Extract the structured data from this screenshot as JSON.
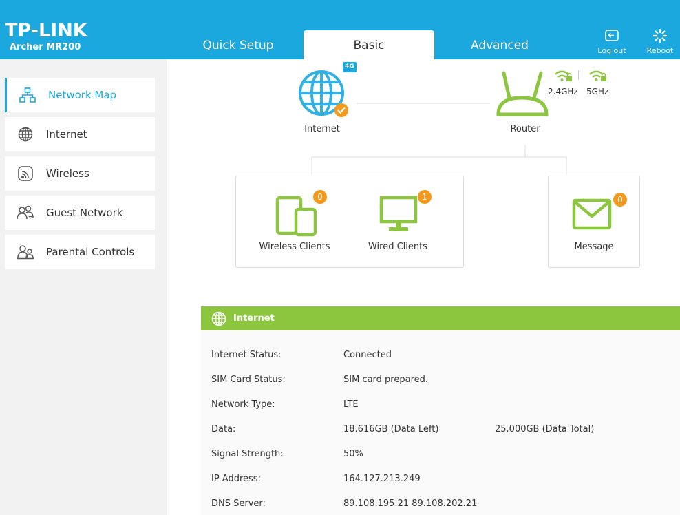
{
  "brand": {
    "logo": "TP-LINK",
    "model": "Archer MR200"
  },
  "tabs": [
    {
      "label": "Quick Setup"
    },
    {
      "label": "Basic"
    },
    {
      "label": "Advanced"
    }
  ],
  "header_buttons": {
    "logout": "Log out",
    "reboot": "Reboot"
  },
  "sidebar": {
    "items": [
      {
        "label": "Network Map",
        "icon": "network-map-icon"
      },
      {
        "label": "Internet",
        "icon": "globe-icon"
      },
      {
        "label": "Wireless",
        "icon": "wireless-icon"
      },
      {
        "label": "Guest Network",
        "icon": "guest-network-icon"
      },
      {
        "label": "Parental Controls",
        "icon": "parental-controls-icon"
      }
    ]
  },
  "map": {
    "internet_label": "Internet",
    "internet_badge": "4G",
    "router_label": "Router",
    "band_24": "2.4GHz",
    "band_5": "5GHz",
    "wireless_clients": {
      "label": "Wireless Clients",
      "count": "0"
    },
    "wired_clients": {
      "label": "Wired Clients",
      "count": "1"
    },
    "message": {
      "label": "Message",
      "count": "0"
    }
  },
  "internet_panel": {
    "title": "Internet",
    "rows": [
      {
        "key": "Internet Status:",
        "value": "Connected"
      },
      {
        "key": "SIM Card Status:",
        "value": "SIM card prepared."
      },
      {
        "key": "Network Type:",
        "value": "LTE"
      },
      {
        "key": "Data:",
        "value": "18.616GB (Data Left)",
        "value2": "25.000GB (Data Total)"
      },
      {
        "key": "Signal Strength:",
        "value": "50%"
      },
      {
        "key": "IP Address:",
        "value": "164.127.213.249"
      },
      {
        "key": "DNS Server:",
        "value": "89.108.195.21 89.108.202.21"
      }
    ]
  },
  "colors": {
    "header": "#1aa8df",
    "accent_green": "#8cc63f",
    "badge_orange": "#f39a1e"
  }
}
